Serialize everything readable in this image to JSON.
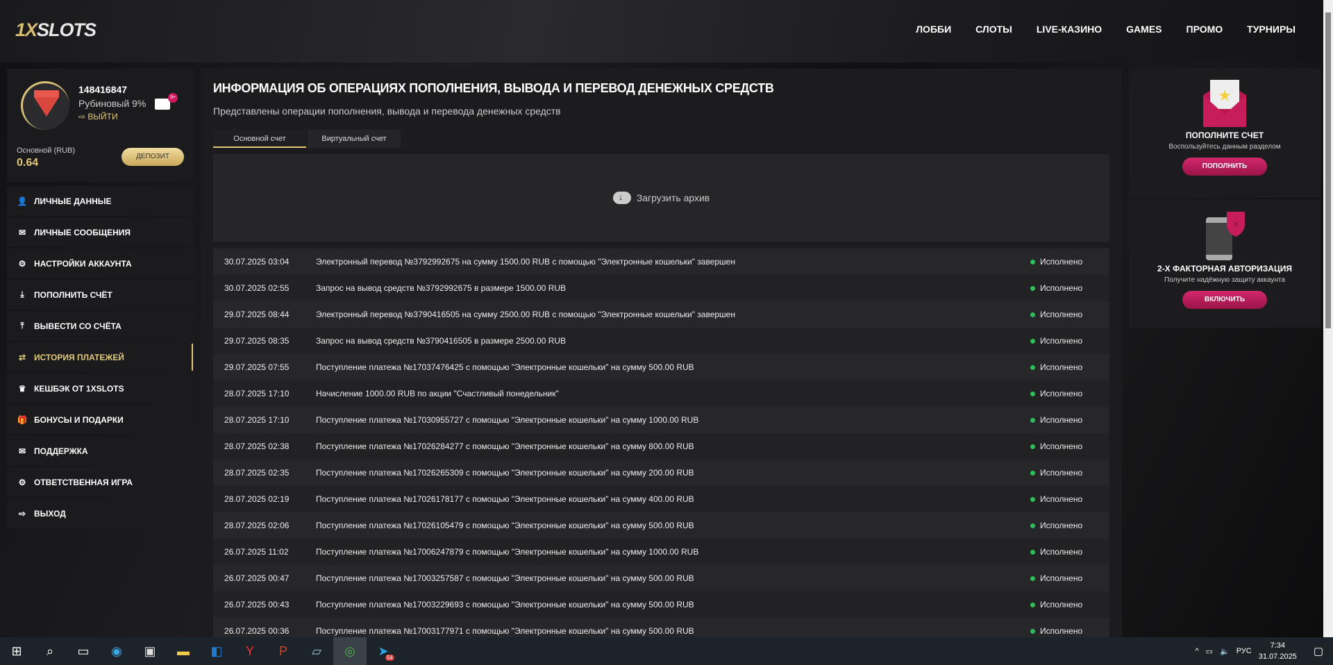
{
  "header": {
    "logo_a": "1X",
    "logo_b": "SLOTS",
    "nav": [
      "ЛОББИ",
      "СЛОТЫ",
      "LIVE-КАЗИНО",
      "GAMES",
      "ПРОМО",
      "ТУРНИРЫ"
    ]
  },
  "profile": {
    "user_id": "148416847",
    "rank": "Рубиновый 9%",
    "logout": "ВЫЙТИ",
    "mail_badge": "9+",
    "balance_label": "Основной (RUB)",
    "balance": "0.64",
    "deposit": "ДЕПОЗИТ"
  },
  "menu": [
    {
      "label": "ЛИЧНЫЕ ДАННЫЕ",
      "icon": "user-plus-icon",
      "glyph": "👤"
    },
    {
      "label": "ЛИЧНЫЕ СООБЩЕНИЯ",
      "icon": "envelope-icon",
      "glyph": "✉"
    },
    {
      "label": "НАСТРОЙКИ АККАУНТА",
      "icon": "gears-icon",
      "glyph": "⚙"
    },
    {
      "label": "ПОПОЛНИТЬ СЧЁТ",
      "icon": "download-icon",
      "glyph": "⤓"
    },
    {
      "label": "ВЫВЕСТИ СО СЧЁТА",
      "icon": "upload-icon",
      "glyph": "⤒"
    },
    {
      "label": "ИСТОРИЯ ПЛАТЕЖЕЙ",
      "icon": "exchange-icon",
      "glyph": "⇄"
    },
    {
      "label": "КЕШБЭК ОТ 1XSLOTS",
      "icon": "crown-icon",
      "glyph": "♛"
    },
    {
      "label": "БОНУСЫ И ПОДАРКИ",
      "icon": "gift-icon",
      "glyph": "🎁"
    },
    {
      "label": "ПОДДЕРЖКА",
      "icon": "envelope-icon",
      "glyph": "✉"
    },
    {
      "label": "ОТВЕТСТВЕННАЯ ИГРА",
      "icon": "gears-icon",
      "glyph": "⚙"
    },
    {
      "label": "ВЫХОД",
      "icon": "sign-out-icon",
      "glyph": "⇨"
    }
  ],
  "main": {
    "title": "ИНФОРМАЦИЯ ОБ ОПЕРАЦИЯХ ПОПОЛНЕНИЯ, ВЫВОДА И ПЕРЕВОД ДЕНЕЖНЫХ СРЕДСТВ",
    "subtitle": "Представлены операции пополнения, вывода и перевода денежных средств",
    "tabs": [
      "Основной счет",
      "Виртуальный счет"
    ],
    "archive": "Загрузить архив",
    "rows": [
      {
        "date": "30.07.2025 03:04",
        "text": "Электронный перевод №3792992675 на сумму 1500.00 RUB с помощью \"Электронные кошельки\" завершен",
        "status": "Исполнено"
      },
      {
        "date": "30.07.2025 02:55",
        "text": "Запрос на вывод средств №3792992675 в размере 1500.00 RUB",
        "status": "Исполнено"
      },
      {
        "date": "29.07.2025 08:44",
        "text": "Электронный перевод №3790416505 на сумму 2500.00 RUB с помощью \"Электронные кошельки\" завершен",
        "status": "Исполнено"
      },
      {
        "date": "29.07.2025 08:35",
        "text": "Запрос на вывод средств №3790416505 в размере 2500.00 RUB",
        "status": "Исполнено"
      },
      {
        "date": "29.07.2025 07:55",
        "text": "Поступление платежа №17037476425 с помощью \"Электронные кошельки\" на сумму 500.00 RUB",
        "status": "Исполнено"
      },
      {
        "date": "28.07.2025 17:10",
        "text": "Начисление 1000.00 RUB по акции \"Счастливый понедельник\"",
        "status": "Исполнено"
      },
      {
        "date": "28.07.2025 17:10",
        "text": "Поступление платежа №17030955727 с помощью \"Электронные кошельки\" на сумму 1000.00 RUB",
        "status": "Исполнено"
      },
      {
        "date": "28.07.2025 02:38",
        "text": "Поступление платежа №17026284277 с помощью \"Электронные кошельки\" на сумму 800.00 RUB",
        "status": "Исполнено"
      },
      {
        "date": "28.07.2025 02:35",
        "text": "Поступление платежа №17026265309 с помощью \"Электронные кошельки\" на сумму 200.00 RUB",
        "status": "Исполнено"
      },
      {
        "date": "28.07.2025 02:19",
        "text": "Поступление платежа №17026178177 с помощью \"Электронные кошельки\" на сумму 400.00 RUB",
        "status": "Исполнено"
      },
      {
        "date": "28.07.2025 02:06",
        "text": "Поступление платежа №17026105479 с помощью \"Электронные кошельки\" на сумму 500.00 RUB",
        "status": "Исполнено"
      },
      {
        "date": "26.07.2025 11:02",
        "text": "Поступление платежа №17006247879 с помощью \"Электронные кошельки\" на сумму 1000.00 RUB",
        "status": "Исполнено"
      },
      {
        "date": "26.07.2025 00:47",
        "text": "Поступление платежа №17003257587 с помощью \"Электронные кошельки\" на сумму 500.00 RUB",
        "status": "Исполнено"
      },
      {
        "date": "26.07.2025 00:43",
        "text": "Поступление платежа №17003229693 с помощью \"Электронные кошельки\" на сумму 500.00 RUB",
        "status": "Исполнено"
      },
      {
        "date": "26.07.2025 00:36",
        "text": "Поступление платежа №17003177971 с помощью \"Электронные кошельки\" на сумму 500.00 RUB",
        "status": "Исполнено"
      }
    ]
  },
  "side": {
    "card1": {
      "title": "ПОПОЛНИТЕ СЧЕТ",
      "text": "Воспользуйтесь данным разделом",
      "button": "ПОПОЛНИТЬ"
    },
    "card2": {
      "title": "2-Х ФАКТОРНАЯ АВТОРИЗАЦИЯ",
      "text": "Получите надёжную защиту аккаунта",
      "button": "ВКЛЮЧИТЬ"
    }
  },
  "taskbar": {
    "lang": "РУС",
    "time": "7:34",
    "date": "31.07.2025",
    "telegram_badge": "54"
  }
}
